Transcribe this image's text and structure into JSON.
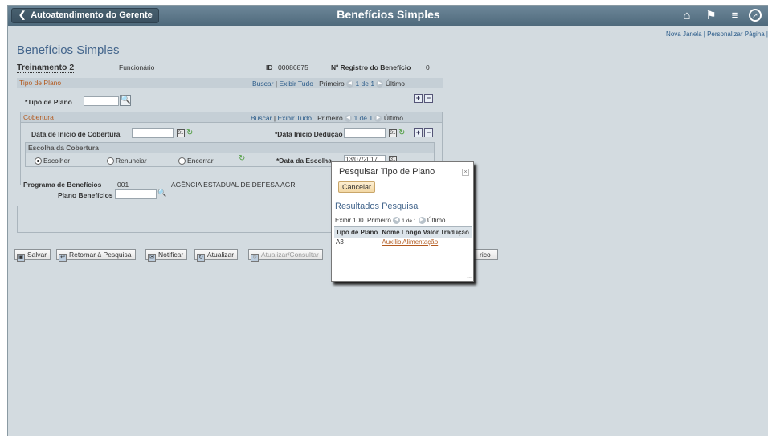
{
  "topbar": {
    "back_label": "Autoatendimento do Gerente",
    "title": "Benefícios Simples",
    "icons": [
      "home-icon",
      "flag-icon",
      "menu-icon",
      "navbar-icon"
    ]
  },
  "toplinks": {
    "new_window": "Nova Janela",
    "sep": "|",
    "personalize": "Personalizar Página",
    "sep2": "|"
  },
  "page": {
    "title": "Benefícios Simples"
  },
  "employee": {
    "name": "Treinamento 2",
    "role": "Funcionário",
    "id_label": "ID",
    "id_value": "00086875",
    "reg_label": "Nº Registro do Benefício",
    "reg_value": "0"
  },
  "plan_type_section": {
    "title": "Tipo de Plano",
    "search": "Buscar",
    "sep": "|",
    "view_all": "Exibir Tudo",
    "first": "Primeiro",
    "count": "1 de 1",
    "last": "Último",
    "field_label": "*Tipo de Plano",
    "field_value": ""
  },
  "coverage_section": {
    "title": "Cobertura",
    "search": "Buscar",
    "sep": "|",
    "view_all": "Exibir Tudo",
    "first": "Primeiro",
    "count": "1 de 1",
    "last": "Último",
    "start_label": "Data de Início de Cobertura",
    "start_value": "",
    "deduction_label": "*Data Início Dedução",
    "deduction_value": ""
  },
  "choice_section": {
    "title": "Escolha da Cobertura",
    "options": [
      "Escolher",
      "Renunciar",
      "Encerrar"
    ],
    "selected": "Escolher",
    "date_label": "*Data da Escolha",
    "date_value": "13/07/2017"
  },
  "program": {
    "label": "Programa de Benefícios",
    "code": "001",
    "name": "AGÊNCIA ESTADUAL DE DEFESA AGR",
    "plan_label": "Plano Benefícios",
    "plan_value": ""
  },
  "toolbar": {
    "save": "Salvar",
    "return_search": "Retornar à Pesquisa",
    "notify": "Notificar",
    "update": "Atualizar",
    "update_view": "Atualizar/Consultar",
    "history": "rico"
  },
  "modal": {
    "title": "Pesquisar Tipo de Plano",
    "close": "×",
    "cancel": "Cancelar",
    "results_title": "Resultados Pesquisa",
    "show": "Exibir 100",
    "first": "Primeiro",
    "count": "1 de 1",
    "last": "Último",
    "columns": [
      "Tipo de Plano",
      "Nome Longo Valor Tradução"
    ],
    "rows": [
      {
        "code": "A3",
        "name": "Auxílio Alimentação"
      }
    ]
  }
}
